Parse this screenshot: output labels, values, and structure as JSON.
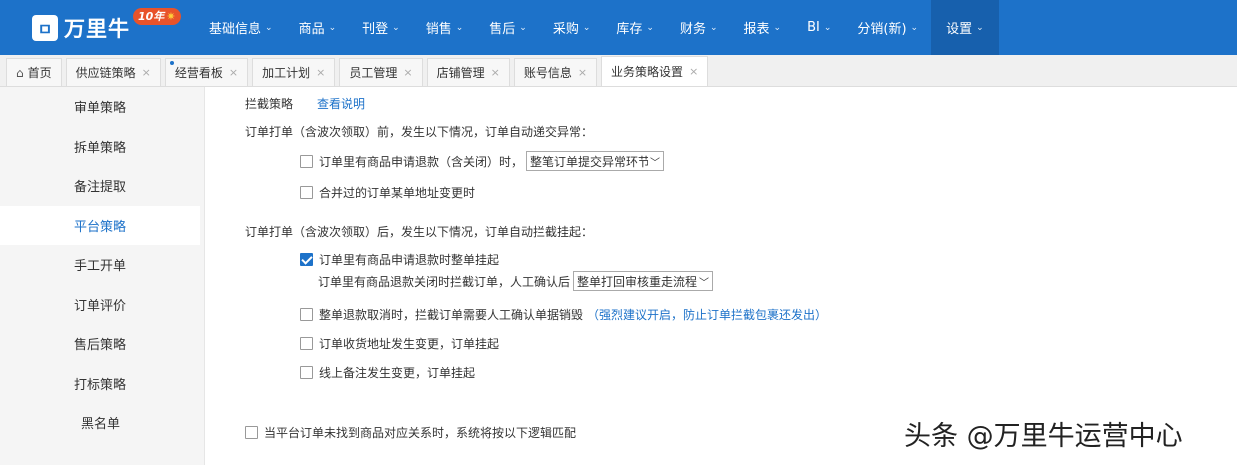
{
  "logo": {
    "text": "万里牛",
    "badge": "10年"
  },
  "nav": {
    "items": [
      {
        "label": "基础信息"
      },
      {
        "label": "商品"
      },
      {
        "label": "刊登"
      },
      {
        "label": "销售"
      },
      {
        "label": "售后"
      },
      {
        "label": "采购"
      },
      {
        "label": "库存"
      },
      {
        "label": "财务"
      },
      {
        "label": "报表"
      },
      {
        "label": "BI"
      },
      {
        "label": "分销(新)"
      },
      {
        "label": "设置",
        "active": true
      }
    ]
  },
  "tabs": [
    {
      "label": "首页"
    },
    {
      "label": "供应链策略"
    },
    {
      "label": "经营看板"
    },
    {
      "label": "加工计划"
    },
    {
      "label": "员工管理"
    },
    {
      "label": "店铺管理"
    },
    {
      "label": "账号信息"
    },
    {
      "label": "业务策略设置",
      "active": true
    }
  ],
  "sidebar": {
    "items": [
      {
        "label": "审单策略"
      },
      {
        "label": "拆单策略"
      },
      {
        "label": "备注提取"
      },
      {
        "label": "平台策略",
        "active": true
      },
      {
        "label": "手工开单"
      },
      {
        "label": "订单评价"
      },
      {
        "label": "售后策略"
      },
      {
        "label": "打标策略"
      },
      {
        "label": "黑名单"
      }
    ]
  },
  "main": {
    "section_title": "拦截策略",
    "help_link": "查看说明",
    "before_print_heading": "订单打单（含波次领取）前，发生以下情况，订单自动递交异常：",
    "before": {
      "refund_label": "订单里有商品申请退款（含关闭）时，",
      "refund_select": "整笔订单提交异常环节",
      "refund_checked": false,
      "address_label": "合并过的订单某单地址变更时",
      "address_checked": false
    },
    "after_print_heading": "订单打单（含波次领取）后，发生以下情况，订单自动拦截挂起：",
    "after": {
      "refund_label": "订单里有商品申请退款时整单挂起",
      "refund_checked": true,
      "refund_sub_label": "订单里有商品退款关闭时拦截订单，人工确认后",
      "refund_sub_select": "整单打回审核重走流程",
      "cancel_label": "整单退款取消时，拦截订单需要人工确认单据销毁",
      "cancel_note": "（强烈建议开启，防止订单拦截包裹还发出）",
      "cancel_checked": false,
      "addr_change_label": "订单收货地址发生变更，订单挂起",
      "addr_change_checked": false,
      "remark_change_label": "线上备注发生变更，订单挂起",
      "remark_change_checked": false
    },
    "match_label": "当平台订单未找到商品对应关系时，系统将按以下逻辑匹配",
    "match_checked": false
  },
  "watermark": "头条 @万里牛运营中心",
  "colors": {
    "nav_bg": "#1d72c9",
    "accent": "#1d72c9"
  }
}
